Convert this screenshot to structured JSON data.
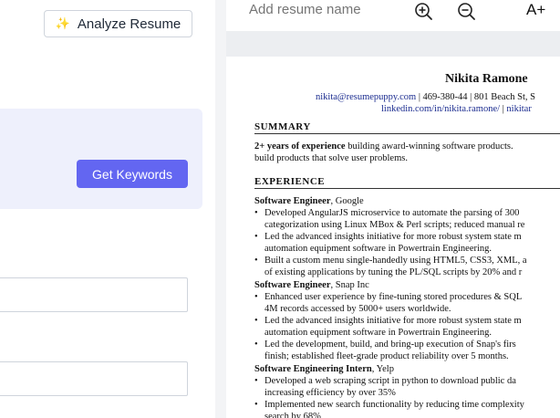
{
  "left": {
    "analyze_button": {
      "icon": "sparkle-icon",
      "label": "Analyze Resume"
    },
    "get_keywords_button": {
      "label": "Get Keywords"
    }
  },
  "toolbar": {
    "resume_name_placeholder": "Add resume name",
    "zoom_in_icon": "zoom-in-icon",
    "zoom_out_icon": "zoom-out-icon",
    "font_size_label": "A+"
  },
  "resume": {
    "name": "Nikita Ramone",
    "contact_email": "nikita@resumepuppy.com",
    "contact_rest": " | 469-380-44 | 801 Beach St, S",
    "contact_linkedin": "linkedin.com/in/nikita.ramone/",
    "contact_sep": " | ",
    "contact_site": "nikitar",
    "summary_heading": "SUMMARY",
    "summary_bold": "2+ years of experience",
    "summary_line1_rest": " building award-winning software products.",
    "summary_line2": "build products that solve user problems.",
    "experience_heading": "EXPERIENCE",
    "jobs": [
      {
        "title": "Software Engineer",
        "company": ", Google",
        "bullets": [
          [
            "Developed AngularJS microservice to automate the parsing of 300",
            "categorization using Linux MBox & Perl scripts; reduced manual re"
          ],
          [
            "Led the advanced insights initiative for more robust system state m",
            "automation equipment software in Powertrain Engineering."
          ],
          [
            "Built a custom menu single-handedly using HTML5, CSS3, XML, a",
            "of existing applications by tuning the PL/SQL scripts by 20% and r"
          ]
        ]
      },
      {
        "title": "Software Engineer",
        "company": ", Snap Inc",
        "bullets": [
          [
            "Enhanced user experience by fine-tuning stored procedures & SQL",
            "4M records accessed by 5000+ users worldwide."
          ],
          [
            "Led the advanced insights initiative for more robust system state m",
            "automation equipment software in Powertrain Engineering."
          ],
          [
            "Led the development, build, and bring-up execution of Snap's firs",
            "finish; established fleet-grade product reliability over 5 months."
          ]
        ]
      },
      {
        "title": "Software Engineering Intern",
        "company": ", Yelp",
        "bullets": [
          [
            "Developed a web scraping script in python to download public da",
            "increasing efficiency by over 35%"
          ],
          [
            "Implemented new search functionality by reducing time complexity",
            "search by 68%"
          ]
        ]
      }
    ]
  }
}
